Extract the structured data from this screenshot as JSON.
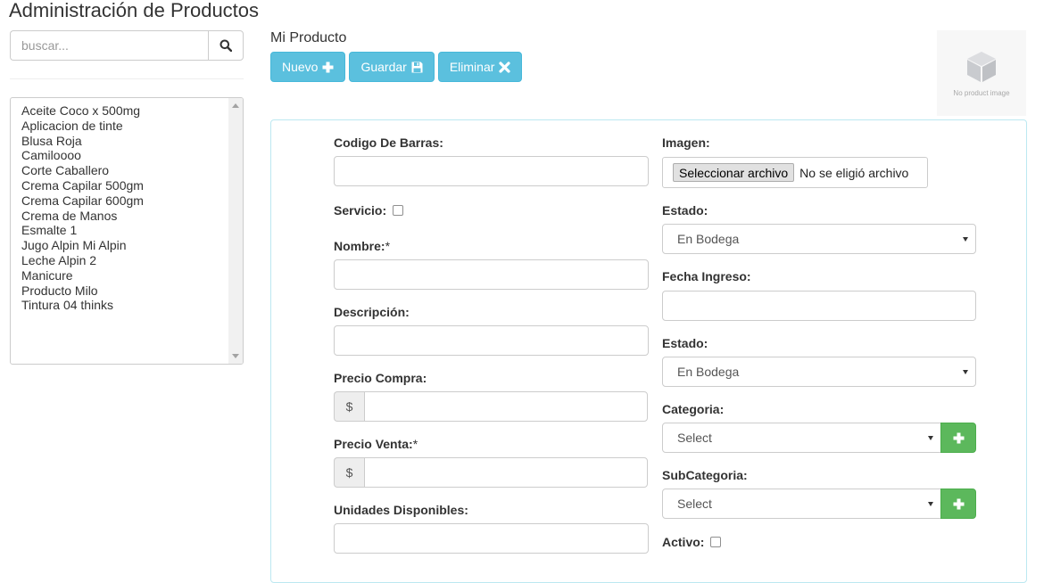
{
  "page": {
    "title": "Administración de Productos"
  },
  "search": {
    "placeholder": "buscar...",
    "value": ""
  },
  "product_list": {
    "items": [
      "Aceite Coco x 500mg",
      "Aplicacion de tinte",
      "Blusa Roja",
      "Camiloooo",
      "Corte Caballero",
      "Crema Capilar 500gm",
      "Crema Capilar 600gm",
      "Crema de Manos",
      "Esmalte 1",
      "Jugo Alpin Mi Alpin",
      "Leche Alpin 2",
      "Manicure",
      "Producto Milo",
      "Tintura 04 thinks"
    ]
  },
  "section": {
    "title": "Mi Producto"
  },
  "toolbar": {
    "new_label": "Nuevo",
    "save_label": "Guardar",
    "delete_label": "Eliminar"
  },
  "product_image": {
    "placeholder_text": "No product image"
  },
  "form": {
    "barcode": {
      "label": "Codigo De Barras:",
      "value": ""
    },
    "service": {
      "label": "Servicio:",
      "checked": false
    },
    "name": {
      "label": "Nombre:",
      "required_mark": "*",
      "value": ""
    },
    "description": {
      "label": "Descripción:",
      "value": ""
    },
    "purchase_price": {
      "label": "Precio Compra:",
      "currency": "$",
      "value": ""
    },
    "sale_price": {
      "label": "Precio Venta:",
      "required_mark": "*",
      "currency": "$",
      "value": ""
    },
    "units_available": {
      "label": "Unidades Disponibles:",
      "value": ""
    },
    "image": {
      "label": "Imagen:",
      "button_label": "Seleccionar archivo",
      "status": "No se eligió archivo"
    },
    "status_1": {
      "label": "Estado:",
      "selected": "En Bodega"
    },
    "entry_date": {
      "label": "Fecha Ingreso:",
      "value": ""
    },
    "status_2": {
      "label": "Estado:",
      "selected": "En Bodega"
    },
    "category": {
      "label": "Categoria:",
      "selected": "Select"
    },
    "subcategory": {
      "label": "SubCategoria:",
      "selected": "Select"
    },
    "active": {
      "label": "Activo:",
      "checked": false
    }
  },
  "colors": {
    "info": "#5bc0de",
    "success": "#5cb85c",
    "panel_border": "#bce8f1"
  },
  "icons": {
    "search": "search-icon",
    "new": "plus-icon",
    "save": "floppy-disk-icon",
    "delete": "close-icon",
    "no_image": "cube-icon",
    "add": "plus-icon"
  }
}
